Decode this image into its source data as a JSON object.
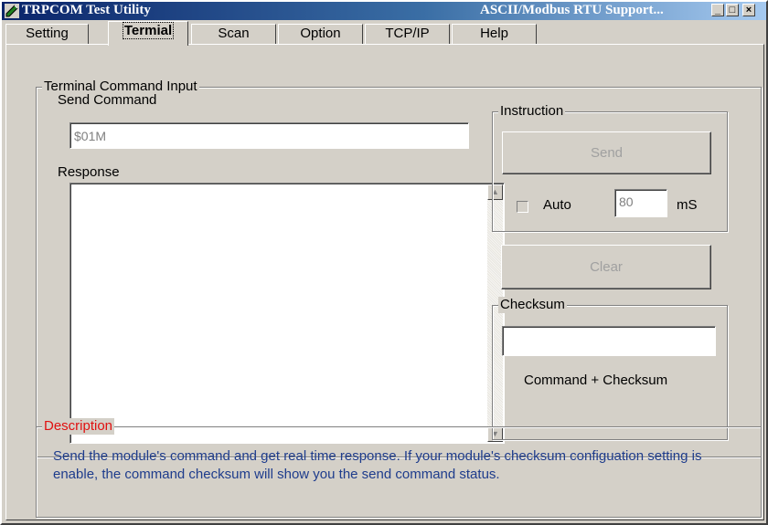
{
  "window": {
    "title": "TRPCOM Test Utility",
    "subtitle": "ASCII/Modbus RTU Support...",
    "minimize_glyph": "_",
    "maximize_glyph": "□",
    "close_glyph": "×"
  },
  "tabs": [
    {
      "label": "Setting",
      "active": false
    },
    {
      "label": "Termial",
      "active": true
    },
    {
      "label": "Scan",
      "active": false
    },
    {
      "label": "Option",
      "active": false
    },
    {
      "label": "TCP/IP",
      "active": false
    },
    {
      "label": "Help",
      "active": false
    }
  ],
  "terminal": {
    "group_title": "Terminal Command Input",
    "send_command_label": "Send Command",
    "send_command_value": "$01M",
    "response_label": "Response",
    "response_value": ""
  },
  "instruction": {
    "group_title": "Instruction",
    "send_label": "Send",
    "auto_label": "Auto",
    "auto_checked": false,
    "interval_value": "80",
    "interval_unit": "mS",
    "clear_label": "Clear"
  },
  "checksum": {
    "group_title": "Checksum",
    "value": "",
    "caption": "Command + Checksum"
  },
  "description": {
    "group_title": "Description",
    "text": "Send the module's command and get  real time response. If your module's checksum configuation setting is enable, the command checksum will show you the send command status."
  },
  "colors": {
    "title_bar_start": "#0a246a",
    "title_bar_end": "#a6caf0",
    "dialog_face": "#d4d0c8",
    "description_title": "#e01010",
    "description_text": "#1e3c8c"
  }
}
